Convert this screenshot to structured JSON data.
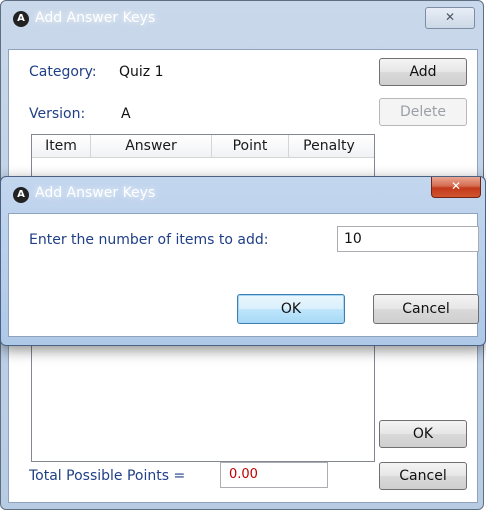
{
  "main_window": {
    "title": "Add Answer Keys",
    "close_glyph": "✕",
    "category_label": "Category:",
    "category_value": "Quiz 1",
    "version_label": "Version:",
    "version_value": "A",
    "add_label": "Add",
    "delete_label": "Delete",
    "table_headers": [
      "Item",
      "Answer",
      "Point",
      "Penalty"
    ],
    "ok_label": "OK",
    "cancel_label": "Cancel",
    "total_label": "Total Possible Points =",
    "total_value": "0.00"
  },
  "dialog": {
    "title": "Add Answer Keys",
    "close_glyph": "✕",
    "prompt": "Enter the number of items to add:",
    "input_value": "10",
    "ok_label": "OK",
    "cancel_label": "Cancel"
  },
  "icons": {
    "app": "app-logo-icon",
    "close": "close-icon"
  },
  "colors": {
    "label_blue": "#1f3f86",
    "total_red": "#c00000",
    "title_glass": "#b7cbe3"
  }
}
